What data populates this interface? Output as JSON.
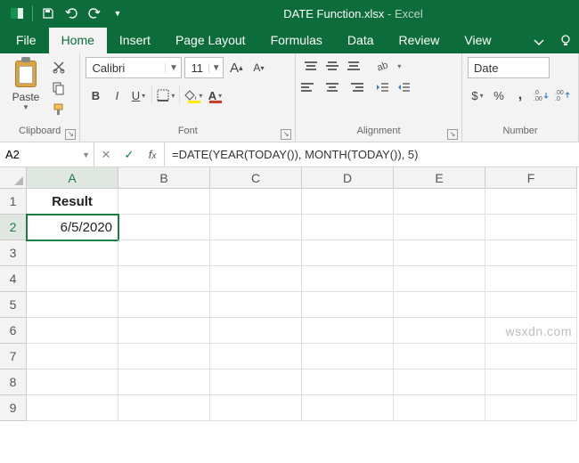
{
  "titlebar": {
    "filename": "DATE Function.xlsx",
    "app_suffix": "Excel"
  },
  "tabs": {
    "file": "File",
    "items": [
      "Home",
      "Insert",
      "Page Layout",
      "Formulas",
      "Data",
      "Review",
      "View"
    ],
    "active_index": 0
  },
  "ribbon": {
    "clipboard": {
      "label": "Clipboard",
      "paste": "Paste"
    },
    "font": {
      "label": "Font",
      "name": "Calibri",
      "size": "11",
      "bold": "B",
      "italic": "I",
      "underline": "U",
      "increase_a": "A",
      "decrease_a": "A"
    },
    "alignment": {
      "label": "Alignment"
    },
    "number": {
      "label": "Number",
      "format": "Date",
      "currency": "$",
      "percent": "%",
      "comma": ",",
      "inc_dec": ".0",
      "dec_dec": ".00"
    }
  },
  "formula_bar": {
    "name_box": "A2",
    "formula": "=DATE(YEAR(TODAY()), MONTH(TODAY()), 5)"
  },
  "grid": {
    "columns": [
      "A",
      "B",
      "C",
      "D",
      "E",
      "F"
    ],
    "rows": [
      "1",
      "2",
      "3",
      "4",
      "5",
      "6",
      "7",
      "8",
      "9"
    ],
    "selected_col": 0,
    "selected_row": 1,
    "data": {
      "A1": "Result",
      "A2": "6/5/2020"
    }
  },
  "watermark": "wsxdn.com"
}
